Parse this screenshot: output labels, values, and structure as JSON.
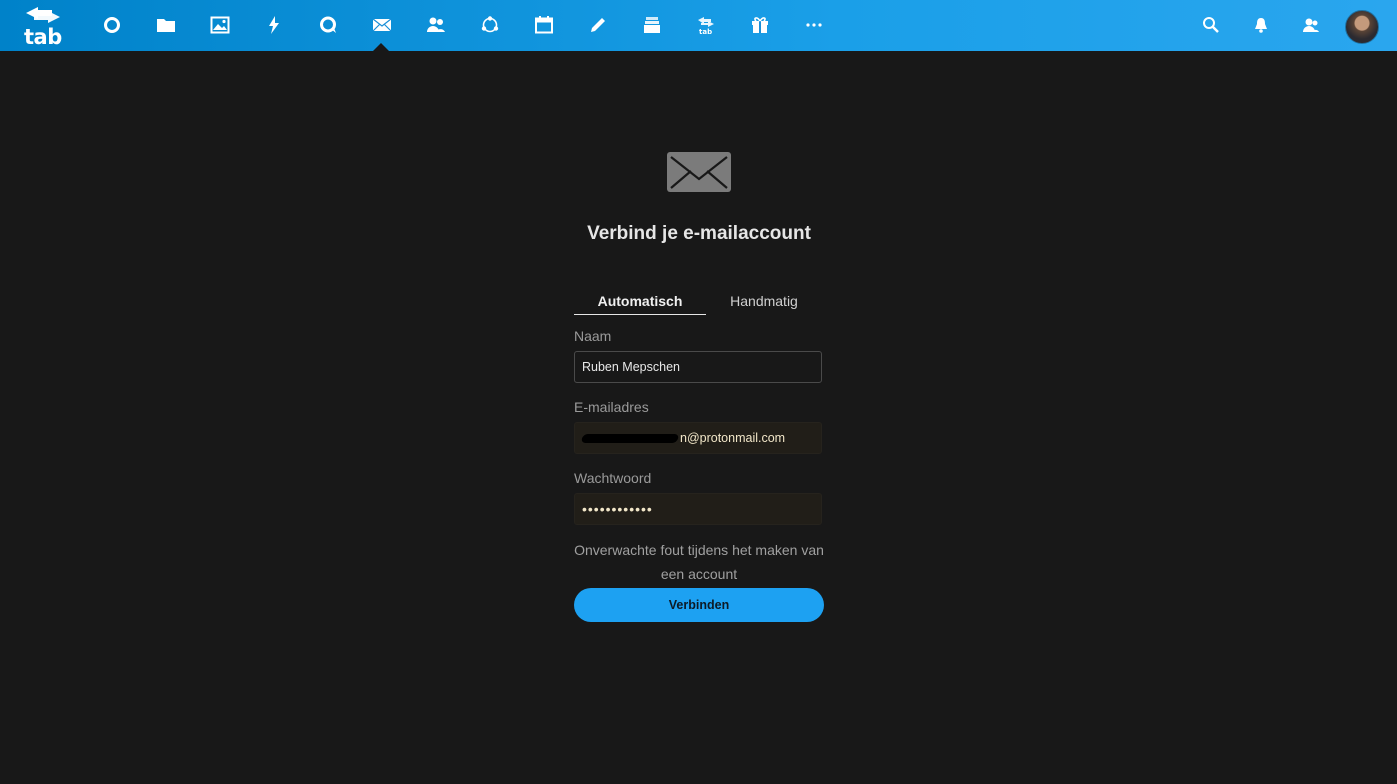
{
  "app": {
    "logo_text": "tab"
  },
  "nav": {
    "items": [
      {
        "icon": "dashboard-circle-icon"
      },
      {
        "icon": "files-folder-icon"
      },
      {
        "icon": "photos-image-icon"
      },
      {
        "icon": "activity-bolt-icon"
      },
      {
        "icon": "talk-chat-icon"
      },
      {
        "icon": "mail-envelope-icon",
        "active": true
      },
      {
        "icon": "contacts-icon"
      },
      {
        "icon": "circles-icon"
      },
      {
        "icon": "calendar-icon"
      },
      {
        "icon": "notes-pencil-icon"
      },
      {
        "icon": "deck-stack-icon"
      },
      {
        "icon": "tab-app-icon"
      },
      {
        "icon": "gift-icon"
      },
      {
        "icon": "more-dots-icon"
      }
    ],
    "right": [
      {
        "icon": "search-icon"
      },
      {
        "icon": "notifications-bell-icon"
      },
      {
        "icon": "contacts-menu-icon"
      },
      {
        "icon": "user-avatar"
      }
    ]
  },
  "setup": {
    "title": "Verbind je e-mailaccount",
    "tabs": {
      "auto": "Automatisch",
      "manual": "Handmatig"
    },
    "name_label": "Naam",
    "name_value": "Ruben Mepschen",
    "email_label": "E-mailadres",
    "email_value_visible": "n@protonmail.com",
    "password_label": "Wachtwoord",
    "password_value": "••••••••••••",
    "error_text": "Onverwachte fout tijdens het maken van een account",
    "submit_label": "Verbinden"
  },
  "colors": {
    "topbar": "#0082c9",
    "background": "#181818",
    "accent_button": "#1da1f2"
  }
}
